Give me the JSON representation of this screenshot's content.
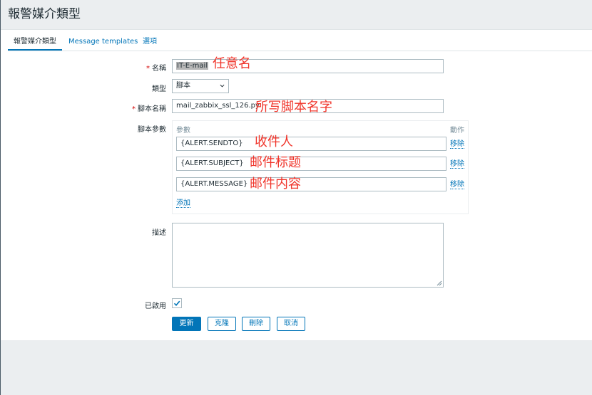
{
  "page": {
    "title": "報警媒介類型"
  },
  "tabs": [
    {
      "label": "報警媒介類型",
      "active": true
    },
    {
      "label": "Message templates",
      "active": false
    },
    {
      "label": "選項",
      "active": false
    }
  ],
  "form": {
    "name": {
      "label": "名稱",
      "required": true,
      "value": "IT-E-mail",
      "annotation": "任意名"
    },
    "type": {
      "label": "類型",
      "value": "腳本"
    },
    "script_name": {
      "label": "腳本名稱",
      "required": true,
      "value": "mail_zabbix_ssl_126.py",
      "annotation": "所写脚本名字"
    },
    "script_params": {
      "label": "腳本參數",
      "col_param": "參數",
      "col_action": "動作",
      "rows": [
        {
          "value": "{ALERT.SENDTO}",
          "remove": "移除",
          "annotation": "收件人"
        },
        {
          "value": "{ALERT.SUBJECT}",
          "remove": "移除",
          "annotation": "邮件标题"
        },
        {
          "value": "{ALERT.MESSAGE}",
          "remove": "移除",
          "annotation": "邮件内容"
        }
      ],
      "add": "添加"
    },
    "description": {
      "label": "描述",
      "value": ""
    },
    "enabled": {
      "label": "已啟用",
      "checked": true
    }
  },
  "buttons": {
    "update": "更新",
    "clone": "克隆",
    "delete": "刪除",
    "cancel": "取消"
  },
  "colors": {
    "accent": "#0275b8",
    "annotation": "#f0352b",
    "required": "#d40000"
  }
}
